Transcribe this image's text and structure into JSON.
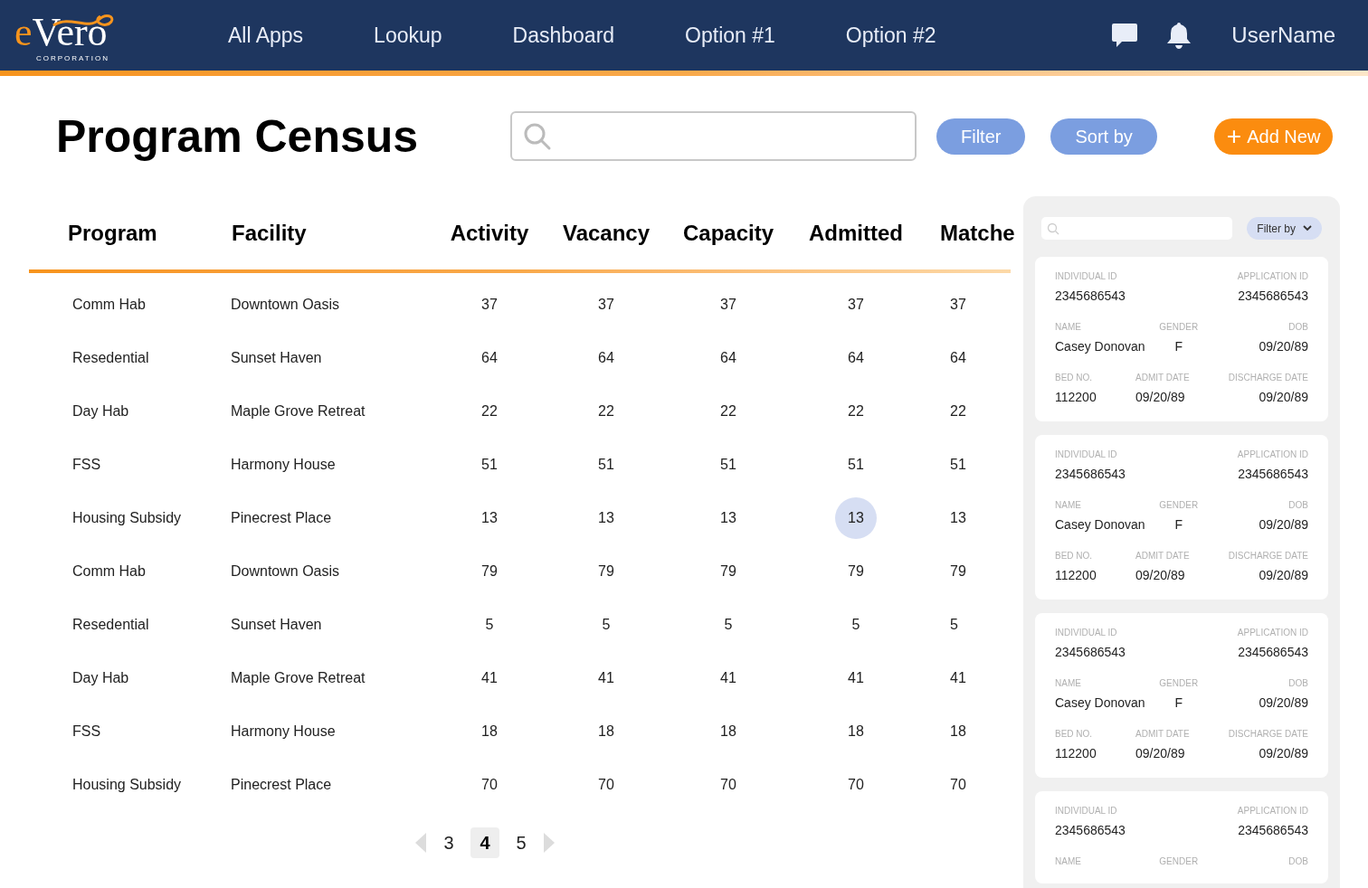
{
  "logo": {
    "initial": "e",
    "rest": "Vero",
    "tagline": "CORPORATION"
  },
  "nav": [
    {
      "label": "All Apps"
    },
    {
      "label": "Lookup"
    },
    {
      "label": "Dashboard"
    },
    {
      "label": "Option #1"
    },
    {
      "label": "Option #2"
    }
  ],
  "user": {
    "name": "UserName"
  },
  "page": {
    "title": "Program Census"
  },
  "buttons": [
    {
      "kind": "secondary",
      "label": "Filter"
    },
    {
      "kind": "secondary",
      "label": "Sort by"
    },
    {
      "kind": "primary",
      "label": "Add New",
      "icon": "+"
    }
  ],
  "table": {
    "columns": [
      "Program",
      "Facility",
      "Activity",
      "Vacancy",
      "Capacity",
      "Admitted",
      "Matche"
    ],
    "rows": [
      {
        "cells": [
          "Comm Hab",
          "Downtown Oasis",
          "37",
          "37",
          "37",
          "37",
          "37"
        ],
        "highlighted": false
      },
      {
        "cells": [
          "Resedential",
          "Sunset Haven",
          "64",
          "64",
          "64",
          "64",
          "64"
        ],
        "highlighted": false
      },
      {
        "cells": [
          "Day Hab",
          "Maple Grove Retreat",
          "22",
          "22",
          "22",
          "22",
          "22"
        ],
        "highlighted": false
      },
      {
        "cells": [
          "FSS",
          "Harmony House",
          "51",
          "51",
          "51",
          "51",
          "51"
        ],
        "highlighted": false
      },
      {
        "cells": [
          "Housing Subsidy",
          "Pinecrest Place",
          "13",
          "13",
          "13",
          "13",
          "13"
        ],
        "highlighted": true
      },
      {
        "cells": [
          "Comm Hab",
          "Downtown Oasis",
          "79",
          "79",
          "79",
          "79",
          "79"
        ],
        "highlighted": false
      },
      {
        "cells": [
          "Resedential",
          "Sunset Haven",
          "5",
          "5",
          "5",
          "5",
          "5"
        ],
        "highlighted": false
      },
      {
        "cells": [
          "Day Hab",
          "Maple Grove Retreat",
          "41",
          "41",
          "41",
          "41",
          "41"
        ],
        "highlighted": false
      },
      {
        "cells": [
          "FSS",
          "Harmony House",
          "18",
          "18",
          "18",
          "18",
          "18"
        ],
        "highlighted": false
      },
      {
        "cells": [
          "Housing Subsidy",
          "Pinecrest Place",
          "70",
          "70",
          "70",
          "70",
          "70"
        ],
        "highlighted": false
      }
    ]
  },
  "pagination": [
    {
      "label": "3",
      "selected": false
    },
    {
      "label": "4",
      "selected": true
    },
    {
      "label": "5",
      "selected": false
    }
  ],
  "panel": {
    "filter_label": "Filter by",
    "cards": [
      {
        "rows": [
          [
            {
              "label": "INDIVIDUAL ID",
              "value": "2345686543"
            },
            null,
            {
              "label": "APPLICATION ID",
              "value": "2345686543"
            }
          ],
          [
            {
              "label": "NAME",
              "value": "Casey Donovan"
            },
            {
              "label": "GENDER",
              "value": "F"
            },
            {
              "label": "DOB",
              "value": "09/20/89"
            }
          ],
          [
            {
              "label": "BED NO.",
              "value": "112200"
            },
            {
              "label": "ADMIT DATE",
              "value": "09/20/89"
            },
            {
              "label": "DISCHARGE DATE",
              "value": "09/20/89"
            }
          ]
        ]
      },
      {
        "rows": [
          [
            {
              "label": "INDIVIDUAL ID",
              "value": "2345686543"
            },
            null,
            {
              "label": "APPLICATION ID",
              "value": "2345686543"
            }
          ],
          [
            {
              "label": "NAME",
              "value": "Casey Donovan"
            },
            {
              "label": "GENDER",
              "value": "F"
            },
            {
              "label": "DOB",
              "value": "09/20/89"
            }
          ],
          [
            {
              "label": "BED NO.",
              "value": "112200"
            },
            {
              "label": "ADMIT DATE",
              "value": "09/20/89"
            },
            {
              "label": "DISCHARGE DATE",
              "value": "09/20/89"
            }
          ]
        ]
      },
      {
        "rows": [
          [
            {
              "label": "INDIVIDUAL ID",
              "value": "2345686543"
            },
            null,
            {
              "label": "APPLICATION ID",
              "value": "2345686543"
            }
          ],
          [
            {
              "label": "NAME",
              "value": "Casey Donovan"
            },
            {
              "label": "GENDER",
              "value": "F"
            },
            {
              "label": "DOB",
              "value": "09/20/89"
            }
          ],
          [
            {
              "label": "BED NO.",
              "value": "112200"
            },
            {
              "label": "ADMIT DATE",
              "value": "09/20/89"
            },
            {
              "label": "DISCHARGE DATE",
              "value": "09/20/89"
            }
          ]
        ]
      },
      {
        "rows": [
          [
            {
              "label": "INDIVIDUAL ID",
              "value": "2345686543"
            },
            null,
            {
              "label": "APPLICATION ID",
              "value": "2345686543"
            }
          ],
          [
            {
              "label": "NAME"
            },
            {
              "label": "GENDER"
            },
            {
              "label": "DOB"
            }
          ]
        ]
      }
    ]
  }
}
